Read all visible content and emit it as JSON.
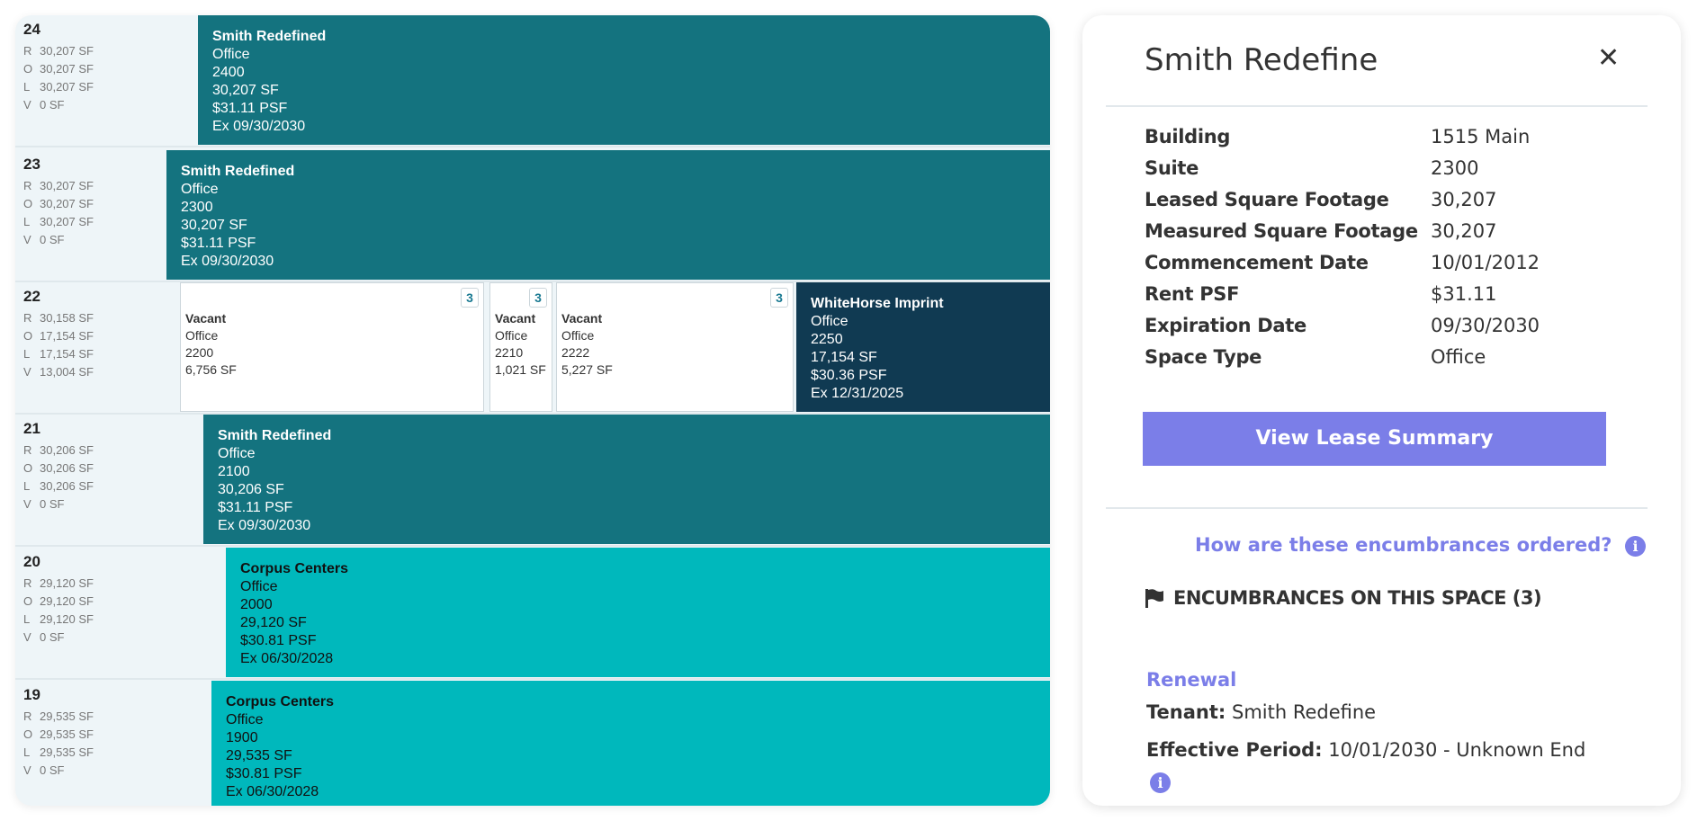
{
  "colors": {
    "leased": "#14737f",
    "leased_light": "#00b8bc",
    "leased_dark": "#103a52",
    "vacant": "#ffffff",
    "accent": "#7b7ee8"
  },
  "floors": [
    {
      "floor": "24",
      "stats": [
        [
          "R",
          "30,207 SF"
        ],
        [
          "O",
          "30,207 SF"
        ],
        [
          "L",
          "30,207 SF"
        ],
        [
          "V",
          "0 SF"
        ]
      ],
      "spaces": [
        {
          "status": "leased",
          "tenant": "Smith Redefined",
          "type": "Office",
          "suite": "2400",
          "sf": "30,207 SF",
          "rent": "$31.11 PSF",
          "exp": "Ex 09/30/2030"
        }
      ]
    },
    {
      "floor": "23",
      "stats": [
        [
          "R",
          "30,207 SF"
        ],
        [
          "O",
          "30,207 SF"
        ],
        [
          "L",
          "30,207 SF"
        ],
        [
          "V",
          "0 SF"
        ]
      ],
      "spaces": [
        {
          "status": "leased",
          "tenant": "Smith Redefined",
          "type": "Office",
          "suite": "2300",
          "sf": "30,207 SF",
          "rent": "$31.11 PSF",
          "exp": "Ex 09/30/2030"
        }
      ]
    },
    {
      "floor": "22",
      "stats": [
        [
          "R",
          "30,158 SF"
        ],
        [
          "O",
          "17,154 SF"
        ],
        [
          "L",
          "17,154 SF"
        ],
        [
          "V",
          "13,004 SF"
        ]
      ],
      "spaces": [
        {
          "status": "vacant",
          "tenant": "Vacant",
          "type": "Office",
          "suite": "2200",
          "sf": "6,756 SF",
          "badge": "3"
        },
        {
          "status": "vacant",
          "tenant": "Vacant",
          "type": "Office",
          "suite": "2210",
          "sf": "1,021 SF",
          "badge": "3"
        },
        {
          "status": "vacant",
          "tenant": "Vacant",
          "type": "Office",
          "suite": "2222",
          "sf": "5,227 SF",
          "badge": "3"
        },
        {
          "status": "leased_dark",
          "tenant": "WhiteHorse Imprint",
          "type": "Office",
          "suite": "2250",
          "sf": "17,154 SF",
          "rent": "$30.36 PSF",
          "exp": "Ex 12/31/2025"
        }
      ]
    },
    {
      "floor": "21",
      "stats": [
        [
          "R",
          "30,206 SF"
        ],
        [
          "O",
          "30,206 SF"
        ],
        [
          "L",
          "30,206 SF"
        ],
        [
          "V",
          "0 SF"
        ]
      ],
      "spaces": [
        {
          "status": "leased",
          "tenant": "Smith Redefined",
          "type": "Office",
          "suite": "2100",
          "sf": "30,206 SF",
          "rent": "$31.11 PSF",
          "exp": "Ex 09/30/2030"
        }
      ]
    },
    {
      "floor": "20",
      "stats": [
        [
          "R",
          "29,120 SF"
        ],
        [
          "O",
          "29,120 SF"
        ],
        [
          "L",
          "29,120 SF"
        ],
        [
          "V",
          "0 SF"
        ]
      ],
      "spaces": [
        {
          "status": "leased_light",
          "tenant": "Corpus Centers",
          "type": "Office",
          "suite": "2000",
          "sf": "29,120 SF",
          "rent": "$30.81 PSF",
          "exp": "Ex 06/30/2028"
        }
      ]
    },
    {
      "floor": "19",
      "stats": [
        [
          "R",
          "29,535 SF"
        ],
        [
          "O",
          "29,535 SF"
        ],
        [
          "L",
          "29,535 SF"
        ],
        [
          "V",
          "0 SF"
        ]
      ],
      "spaces": [
        {
          "status": "leased_light",
          "tenant": "Corpus Centers",
          "type": "Office",
          "suite": "1900",
          "sf": "29,535 SF",
          "rent": "$30.81 PSF",
          "exp": "Ex 06/30/2028"
        }
      ]
    }
  ],
  "panel": {
    "title": "Smith Redefine",
    "close_icon": "close-x",
    "details": [
      {
        "label": "Building",
        "value": "1515 Main"
      },
      {
        "label": "Suite",
        "value": "2300"
      },
      {
        "label": "Leased Square Footage",
        "value": "30,207"
      },
      {
        "label": "Measured Square Footage",
        "value": "30,207"
      },
      {
        "label": "Commencement Date",
        "value": "10/01/2012"
      },
      {
        "label": "Rent PSF",
        "value": "$31.11"
      },
      {
        "label": "Expiration Date",
        "value": "09/30/2030"
      },
      {
        "label": "Space Type",
        "value": "Office"
      }
    ],
    "button": "View Lease Summary",
    "how_link": "How are these encumbrances ordered?",
    "enc_heading": "ENCUMBRANCES ON THIS SPACE (3)",
    "encumbrance": {
      "type": "Renewal",
      "tenant_label": "Tenant:",
      "tenant": "Smith Redefine",
      "period_label": "Effective Period:",
      "period": "10/01/2030 - Unknown End"
    }
  }
}
